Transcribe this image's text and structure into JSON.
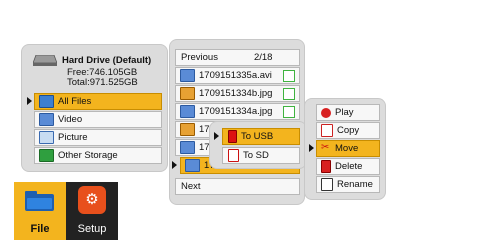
{
  "drive": {
    "name": "Hard Drive (Default)",
    "free": "Free:746.105GB",
    "total": "Total:971.525GB"
  },
  "categories": [
    {
      "label": "All Files",
      "selected": true,
      "icon": "folder-files-icon"
    },
    {
      "label": "Video",
      "selected": false,
      "icon": "video-icon"
    },
    {
      "label": "Picture",
      "selected": false,
      "icon": "picture-icon"
    },
    {
      "label": "Other Storage",
      "selected": false,
      "icon": "storage-icon"
    }
  ],
  "filelist": {
    "previous": "Previous",
    "page": "2/18",
    "next": "Next",
    "files": [
      {
        "name": "1709151335a.avi",
        "type": "video"
      },
      {
        "name": "1709151334b.jpg",
        "type": "picture"
      },
      {
        "name": "1709151334a.jpg",
        "type": "video"
      },
      {
        "name": "17",
        "type": "picture"
      },
      {
        "name": "17",
        "type": "video"
      },
      {
        "name": "17",
        "type": "video"
      }
    ]
  },
  "copy_target_menu": [
    {
      "label": "To USB",
      "selected": true
    },
    {
      "label": "To SD",
      "selected": false
    }
  ],
  "action_menu": [
    {
      "label": "Play",
      "icon": "play-icon"
    },
    {
      "label": "Copy",
      "icon": "copy-icon"
    },
    {
      "label": "Move",
      "icon": "move-icon",
      "selected": true
    },
    {
      "label": "Delete",
      "icon": "delete-icon"
    },
    {
      "label": "Rename",
      "icon": "rename-icon"
    }
  ],
  "taskbar": {
    "file_label": "File",
    "setup_label": "Setup"
  },
  "colors": {
    "highlight": "#f3b41e",
    "setup": "#e8501c",
    "file_tab": "#f3b41e"
  }
}
